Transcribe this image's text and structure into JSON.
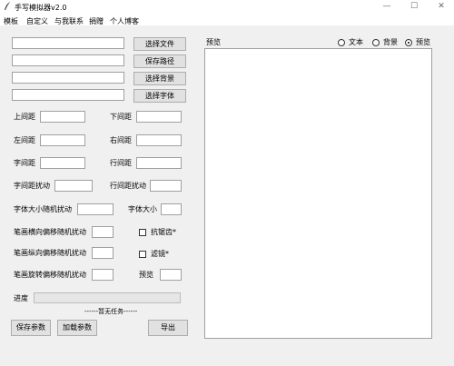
{
  "window": {
    "title": "手写模拟器v2.0",
    "minimize_glyph": "—",
    "maximize_glyph": "☐",
    "close_glyph": "✕"
  },
  "menu": [
    "模板",
    "自定义",
    "与我联系",
    "捐赠",
    "个人博客"
  ],
  "file_rows": [
    {
      "value": "",
      "button": "选择文件"
    },
    {
      "value": "",
      "button": "保存路径"
    },
    {
      "value": "",
      "button": "选择背景"
    },
    {
      "value": "",
      "button": "选择字体"
    }
  ],
  "margins": {
    "top": "上间距",
    "bottom": "下间距",
    "left": "左间距",
    "right": "右间距",
    "char_spacing": "字间距",
    "line_spacing": "行间距",
    "char_jitter": "字间距扰动",
    "line_jitter": "行间距扰动",
    "font_size_jitter": "字体大小随机扰动",
    "font_size": "字体大小"
  },
  "stroke": {
    "h_offset": "笔画横向偏移随机扰动",
    "v_offset": "笔画纵向偏移随机扰动",
    "rotation": "笔画旋转偏移随机扰动",
    "anti_aliasing": "抗锯齿*",
    "filter": "滤镜*",
    "preview_label": "预览"
  },
  "progress": {
    "label": "进度",
    "status": "------暂无任务------",
    "value": 0
  },
  "bottom_buttons": {
    "save_params": "保存参数",
    "load_params": "加载参数",
    "export": "导出"
  },
  "preview": {
    "title": "预览",
    "radio_options": [
      "文本",
      "背景",
      "预览"
    ],
    "selected": "预览"
  }
}
